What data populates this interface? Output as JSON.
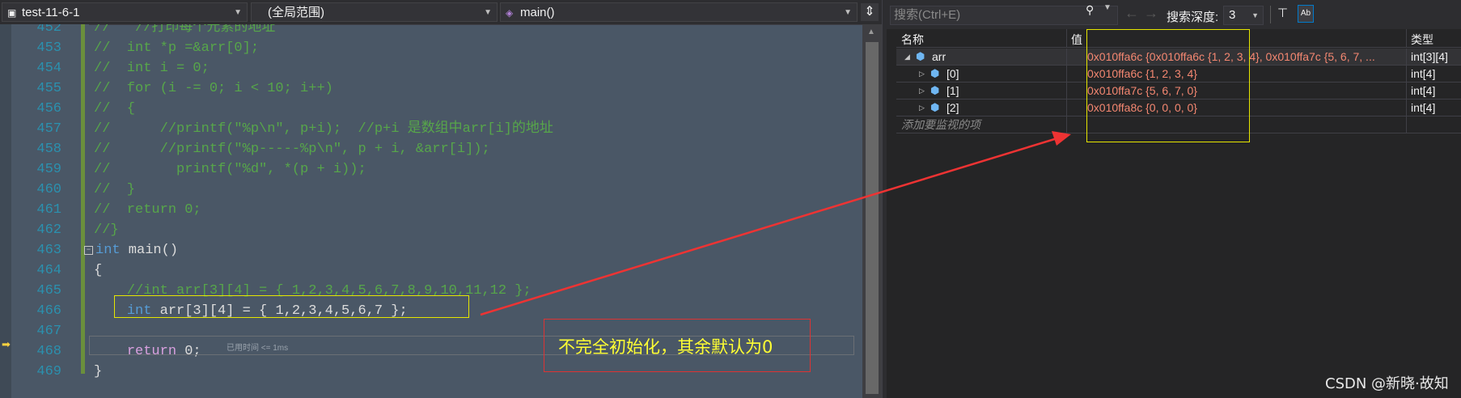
{
  "editor": {
    "project_combo": "test-11-6-1",
    "scope_combo": "(全局范围)",
    "function_combo": "main()",
    "lines": [
      {
        "num": "452",
        "text": "//   //打印每个元素的地址",
        "cls": "cm"
      },
      {
        "num": "453",
        "text": "//  int *p =&arr[0];",
        "cls": "cm"
      },
      {
        "num": "454",
        "text": "//  int i = 0;",
        "cls": "cm"
      },
      {
        "num": "455",
        "text": "//  for (i -= 0; i < 10; i++)",
        "cls": "cm"
      },
      {
        "num": "456",
        "text": "//  {",
        "cls": "cm"
      },
      {
        "num": "457",
        "text": "//      //printf(\"%p\\n\", p+i);  //p+i 是数组中arr[i]的地址",
        "cls": "cm"
      },
      {
        "num": "458",
        "text": "//      //printf(\"%p-----%p\\n\", p + i, &arr[i]);",
        "cls": "cm"
      },
      {
        "num": "459",
        "text": "//        printf(\"%d\", *(p + i));",
        "cls": "cm"
      },
      {
        "num": "460",
        "text": "//  }",
        "cls": "cm"
      },
      {
        "num": "461",
        "text": "//  return 0;",
        "cls": "cm"
      },
      {
        "num": "462",
        "text": "//}",
        "cls": "cm"
      },
      {
        "num": "463",
        "text": "",
        "cls": "pl"
      },
      {
        "num": "464",
        "text": "{",
        "cls": "pl"
      },
      {
        "num": "465",
        "text": "    //int arr[3][4] = { 1,2,3,4,5,6,7,8,9,10,11,12 };",
        "cls": "cm"
      },
      {
        "num": "466",
        "text": "",
        "cls": "pl"
      },
      {
        "num": "467",
        "text": "",
        "cls": "pl"
      },
      {
        "num": "468",
        "text": "",
        "cls": "pl"
      },
      {
        "num": "469",
        "text": "}",
        "cls": "pl"
      }
    ],
    "line463": {
      "kw": "int",
      "rest": " main()"
    },
    "line466": {
      "kw": "int",
      "rest": " arr[3][4] = { 1,2,3,4,5,6,7 };"
    },
    "line468": {
      "kw": "return",
      "rest": " 0;"
    },
    "elapsed": "已用时间 <= 1ms",
    "annotation": "不完全初始化，其余默认为0"
  },
  "watch": {
    "search_placeholder": "搜索(Ctrl+E)",
    "depth_label": "搜索深度:",
    "depth_value": "3",
    "columns": {
      "name": "名称",
      "value": "值",
      "type": "类型"
    },
    "rows": [
      {
        "name": "arr",
        "value": "0x010ffa6c {0x010ffa6c {1, 2, 3, 4}, 0x010ffa7c {5, 6, 7, ...",
        "type": "int[3][4]"
      },
      {
        "name": "[0]",
        "value": "0x010ffa6c {1, 2, 3, 4}",
        "type": "int[4]"
      },
      {
        "name": "[1]",
        "value": "0x010ffa7c {5, 6, 7, 0}",
        "type": "int[4]"
      },
      {
        "name": "[2]",
        "value": "0x010ffa8c {0, 0, 0, 0}",
        "type": "int[4]"
      }
    ],
    "add_watch": "添加要监视的项"
  },
  "watermark": "CSDN @新晓·故知",
  "colors": {
    "comment": "#57a64a",
    "keyword": "#569cd6",
    "control_keyword": "#d8a0df",
    "highlight": "#e6e600",
    "annotation_border": "#dd3333",
    "value_text": "#f48771"
  }
}
